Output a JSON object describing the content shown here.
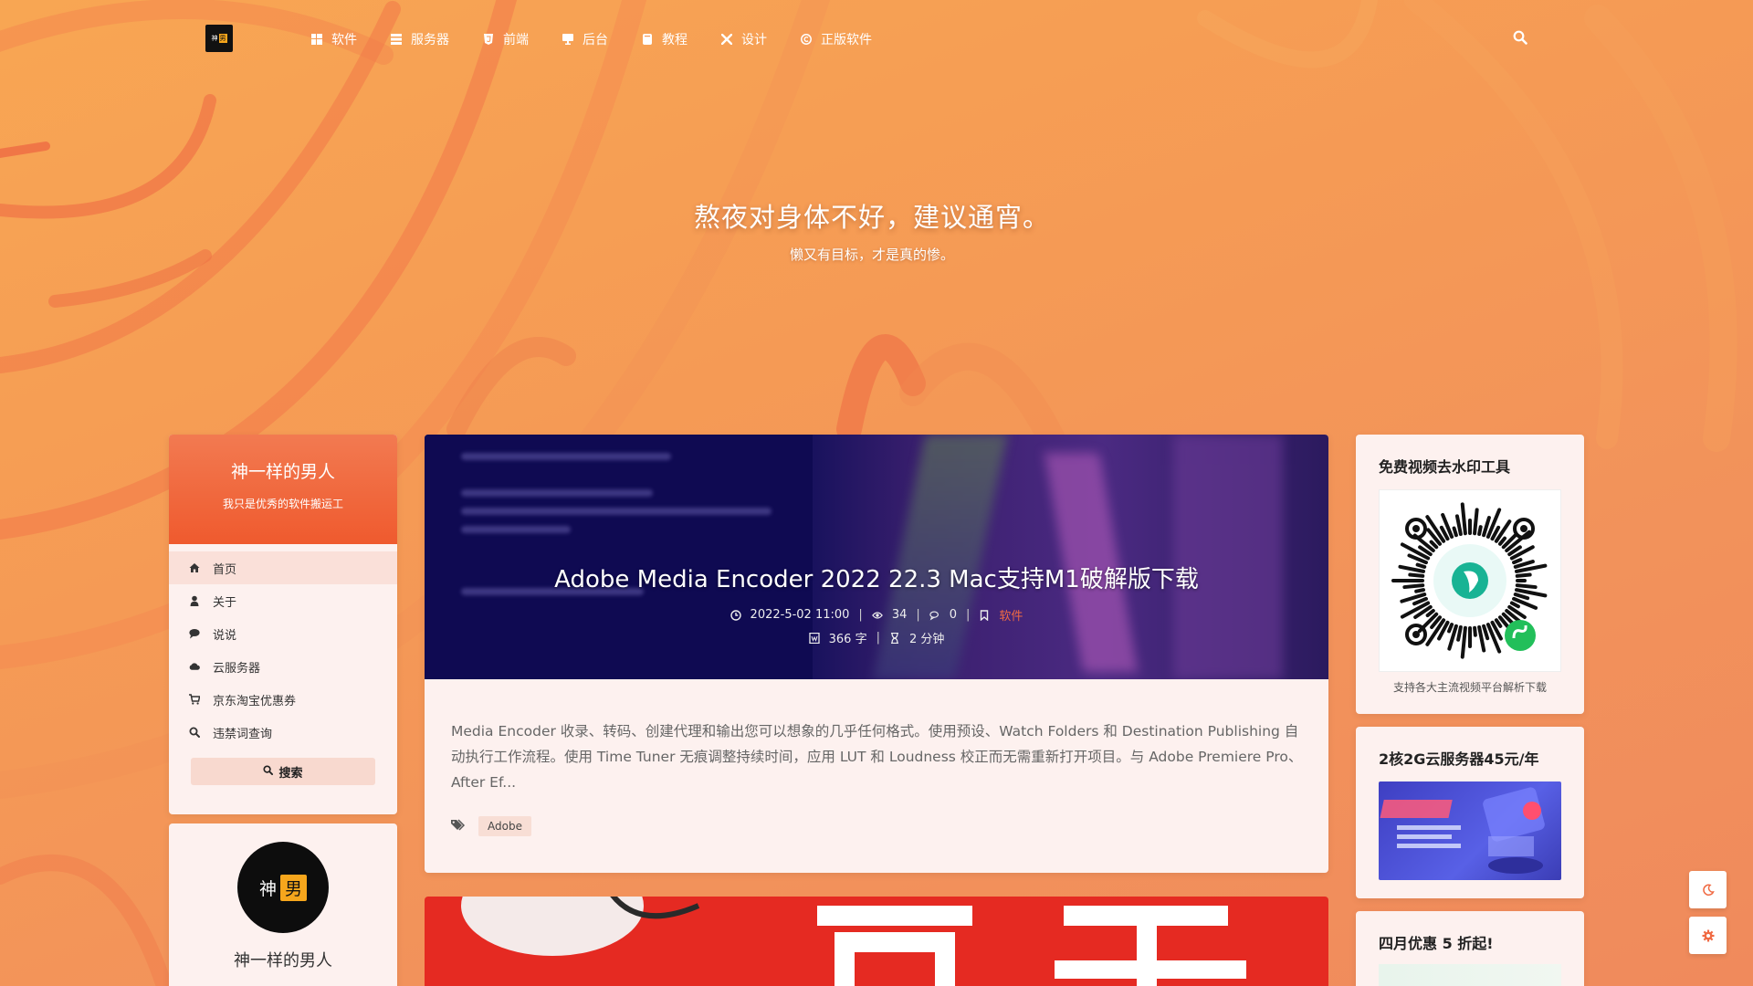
{
  "header": {
    "logo_left": "神",
    "logo_right": "男",
    "nav": [
      {
        "label": "软件",
        "icon": "windows-icon"
      },
      {
        "label": "服务器",
        "icon": "server-icon"
      },
      {
        "label": "前端",
        "icon": "html5-icon"
      },
      {
        "label": "后台",
        "icon": "monitor-icon"
      },
      {
        "label": "教程",
        "icon": "book-icon"
      },
      {
        "label": "设计",
        "icon": "wrench-icon"
      },
      {
        "label": "正版软件",
        "icon": "copyright-icon"
      }
    ],
    "search_icon": "search-icon"
  },
  "hero": {
    "title": "熬夜对身体不好，建议通宵。",
    "subtitle": "懒又有目标，才是真的惨。"
  },
  "sidebar": {
    "profile": {
      "name": "神一样的男人",
      "motto": "我只是优秀的软件搬运工"
    },
    "nav": [
      {
        "label": "首页",
        "icon": "home-icon"
      },
      {
        "label": "关于",
        "icon": "user-icon"
      },
      {
        "label": "说说",
        "icon": "comment-icon"
      },
      {
        "label": "云服务器",
        "icon": "cloud-icon"
      },
      {
        "label": "京东淘宝优惠券",
        "icon": "cart-icon"
      },
      {
        "label": "违禁词查询",
        "icon": "search-icon"
      }
    ],
    "search_button": "搜索",
    "author": {
      "avatar_left": "神",
      "avatar_right": "男",
      "name": "神一样的男人"
    }
  },
  "post": {
    "title": "Adobe Media Encoder 2022 22.3 Mac支持M1破解版下载",
    "date": "2022-5-02 11:00",
    "views": "34",
    "comments": "0",
    "category": "软件",
    "words": "366 字",
    "read_time": "2 分钟",
    "excerpt": "Media Encoder 收录、转码、创建代理和输出您可以想象的几乎任何格式。使用预设、Watch Folders 和 Destination Publishing 自动执行工作流程。使用 Time Tuner 无痕调整持续时间，应用 LUT 和 Loudness 校正而无需重新打开项目。与 Adobe Premiere Pro、After Ef...",
    "tags": [
      "Adobe"
    ]
  },
  "widgets": {
    "watermark": {
      "title": "免费视频去水印工具",
      "caption": "支持各大主流视频平台解析下载"
    },
    "cloud": {
      "title": "2核2G云服务器45元/年"
    },
    "promo": {
      "title": "四月优惠 5 折起!"
    }
  },
  "float_buttons": [
    "moon-icon",
    "gear-icon"
  ],
  "colors": {
    "accent": "#f06a43",
    "card_bg": "#fdf1ef",
    "header_gradient_top": "#f27a51",
    "header_gradient_bottom": "#ef5a2e"
  }
}
